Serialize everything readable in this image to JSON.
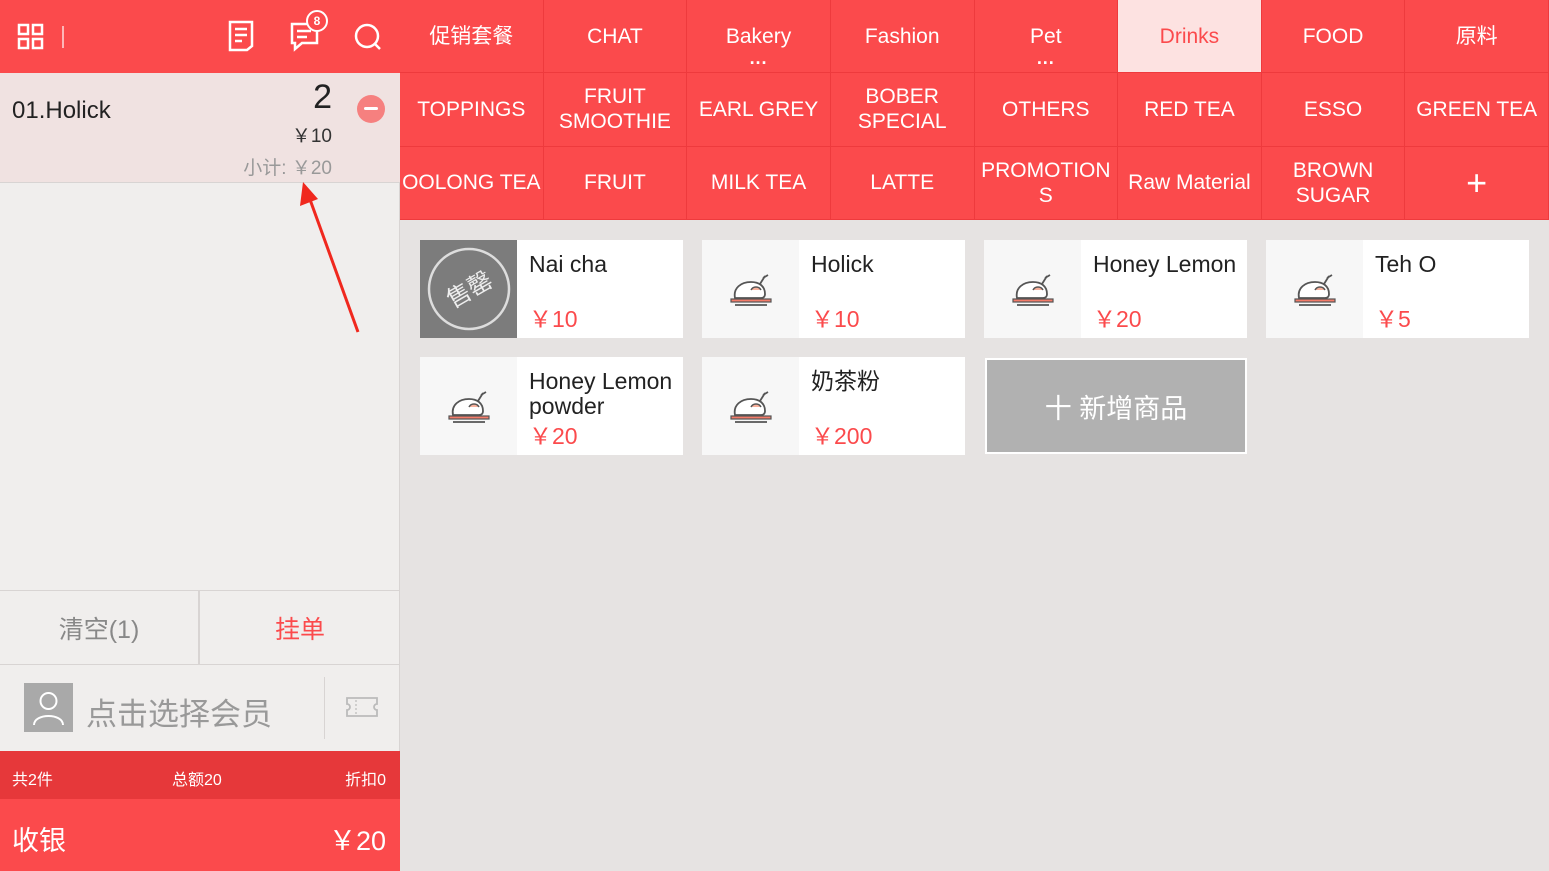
{
  "header": {
    "badge_count": "8"
  },
  "order": {
    "items": [
      {
        "name": "01.Holick",
        "qty": "2",
        "price": "￥10",
        "subtotal": "小计: ￥20"
      }
    ]
  },
  "actions": {
    "clear_label": "清空(1)",
    "hang_label": "挂单"
  },
  "member": {
    "placeholder": "点击选择会员"
  },
  "summary": {
    "count": "共2件",
    "total": "总额20",
    "discount": "折扣0"
  },
  "cashier": {
    "label": "收银",
    "total": "￥20"
  },
  "categories": [
    {
      "label": "促销套餐"
    },
    {
      "label": "CHAT"
    },
    {
      "label": "Bakery",
      "more": "···"
    },
    {
      "label": "Fashion"
    },
    {
      "label": "Pet",
      "more": "···"
    },
    {
      "label": "Drinks",
      "active": true
    },
    {
      "label": "FOOD"
    },
    {
      "label": "原料"
    },
    {
      "label": "TOPPINGS"
    },
    {
      "label": "FRUIT SMOOTHIE"
    },
    {
      "label": "EARL GREY"
    },
    {
      "label": "BOBER SPECIAL"
    },
    {
      "label": "OTHERS"
    },
    {
      "label": "RED TEA"
    },
    {
      "label": "ESSO"
    },
    {
      "label": "GREEN TEA"
    },
    {
      "label": "OOLONG TEA"
    },
    {
      "label": "FRUIT"
    },
    {
      "label": "MILK TEA"
    },
    {
      "label": "LATTE"
    },
    {
      "label": "PROMOTION S"
    },
    {
      "label": "Raw Material"
    },
    {
      "label": "BROWN SUGAR"
    },
    {
      "label": "+"
    }
  ],
  "products": [
    {
      "name": "Nai cha",
      "price": "￥10",
      "soldout": true,
      "soldout_text": "售罄"
    },
    {
      "name": "Holick",
      "price": "￥10"
    },
    {
      "name": "Honey Lemon",
      "price": "￥20"
    },
    {
      "name": "Teh O",
      "price": "￥5"
    },
    {
      "name": "Honey Lemon powder",
      "price": "￥20"
    },
    {
      "name": "奶茶粉",
      "price": "￥200"
    }
  ],
  "add_product_label": "十 新增商品",
  "colors": {
    "brand": "#fb4a4c",
    "active_tab_bg": "#fde2e1",
    "price": "#fb4a4c"
  }
}
